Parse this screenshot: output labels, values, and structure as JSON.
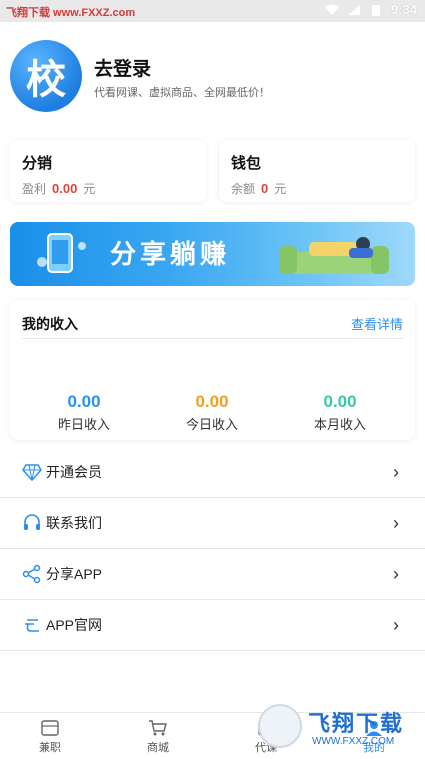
{
  "status": {
    "watermark": "飞翔下载 www.FXXZ.com",
    "time": "9:34"
  },
  "profile": {
    "avatar_char": "校",
    "title": "去登录",
    "subtitle": "代看网课、虚拟商品、全网最低价！"
  },
  "cards": {
    "distribution": {
      "title": "分销",
      "label": "盈利",
      "value": "0.00",
      "unit": "元"
    },
    "wallet": {
      "title": "钱包",
      "label": "余额",
      "value": "0",
      "unit": "元"
    }
  },
  "banner": {
    "text": "分享躺赚"
  },
  "income": {
    "title": "我的收入",
    "link": "查看详情",
    "stats": [
      {
        "value": "0.00",
        "label": "昨日收入",
        "color": "#2b8ff0"
      },
      {
        "value": "0.00",
        "label": "今日收入",
        "color": "#f0a020"
      },
      {
        "value": "0.00",
        "label": "本月收入",
        "color": "#3cc8a8"
      }
    ]
  },
  "menu": [
    {
      "label": "开通会员",
      "icon": "diamond-icon"
    },
    {
      "label": "联系我们",
      "icon": "headset-icon"
    },
    {
      "label": "分享APP",
      "icon": "share-icon"
    },
    {
      "label": "APP官网",
      "icon": "website-icon"
    }
  ],
  "tabs": [
    {
      "label": "兼职",
      "icon": "parttime-icon"
    },
    {
      "label": "商城",
      "icon": "cart-icon"
    },
    {
      "label": "代课",
      "icon": "class-icon"
    },
    {
      "label": "我的",
      "icon": "profile-icon"
    }
  ],
  "bottom_watermark": {
    "text": "飞翔下载",
    "url": "WWW.FXXZ.COM"
  },
  "colors": {
    "accent": "#2b8ff0",
    "money": "#e0423a"
  }
}
